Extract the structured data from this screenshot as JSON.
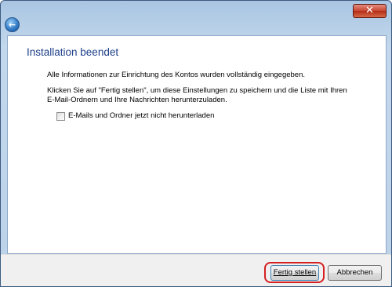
{
  "titlebar": {
    "close_label": "✕",
    "back_label": "←"
  },
  "main": {
    "heading": "Installation beendet",
    "info_text": "Alle Informationen zur Einrichtung des Kontos wurden vollständig eingegeben.",
    "instruction_line1": "Klicken Sie auf \"Fertig stellen\", um diese Einstellungen zu speichern und die Liste mit Ihren",
    "instruction_line2": "E-Mail-Ordnern und Ihre Nachrichten herunterzuladen.",
    "checkbox": {
      "label": "E-Mails und Ordner jetzt nicht herunterladen",
      "checked": false
    }
  },
  "footer": {
    "finish_label": "Fertig stellen",
    "cancel_label": "Abbrechen"
  },
  "colors": {
    "heading": "#1e3f8a",
    "highlight": "#d42020",
    "close": "#c64530"
  }
}
